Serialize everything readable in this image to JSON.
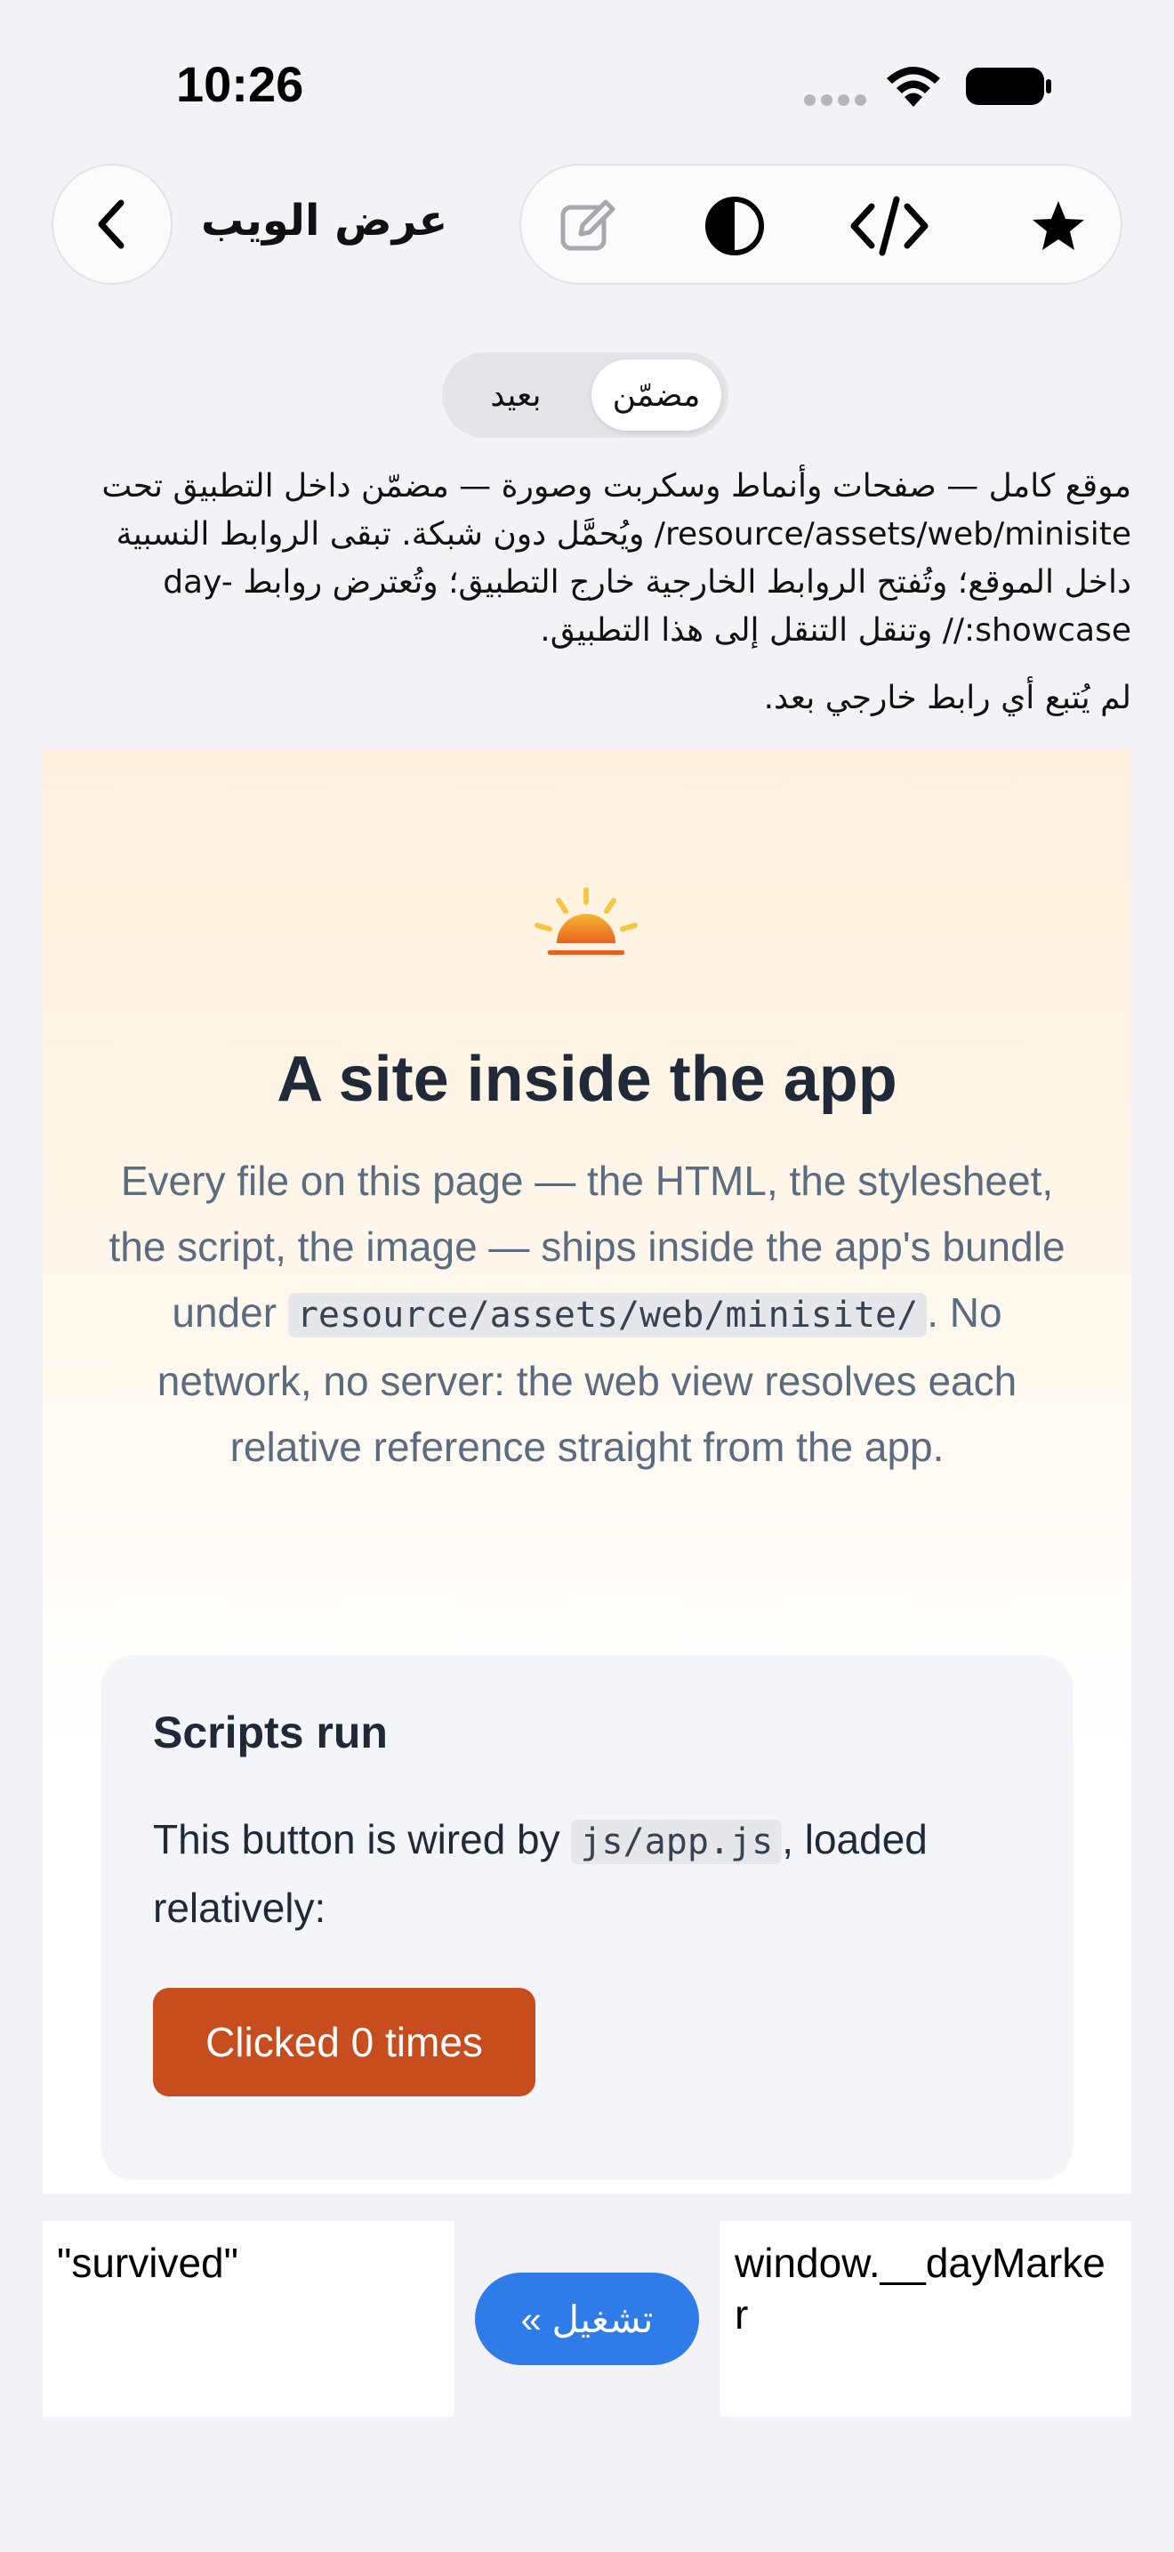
{
  "status_bar": {
    "time": "10:26",
    "icons": [
      "signal-dots-icon",
      "wifi-icon",
      "battery-icon"
    ]
  },
  "nav": {
    "back_icon": "chevron-left-icon",
    "title": "عرض الويب",
    "toolbar_icons": [
      "edit-icon",
      "contrast-icon",
      "code-icon",
      "star-icon"
    ]
  },
  "segmented": {
    "selected": "مضمّن",
    "other": "بعيد"
  },
  "description": "موقع كامل — صفحات وأنماط وسكربت وصورة — مضمّن داخل التطبيق تحت resource/assets/web/minisite/ ويُحمَّل دون شبكة. تبقى الروابط النسبية داخل الموقع؛ وتُفتح الروابط الخارجية خارج التطبيق؛ وتُعترض روابط day-showcase:// وتنقل التنقل إلى هذا التطبيق.",
  "status_message": "لم يُتبع أي رابط خارجي بعد.",
  "site": {
    "title": "A site inside the app",
    "lead_part1": "Every file on this page — the HTML, the stylesheet, the script, the image — ships inside the app's bundle under",
    "lead_code": "resource/assets/web/minisite/",
    "lead_part2": ". No network, no server: the web view resolves each relative reference straight from the app.",
    "card": {
      "title": "Scripts run",
      "text_part1": "This button is wired by",
      "text_code": "js/app.js",
      "text_part2": ", loaded relatively:",
      "button_label": "Clicked 0 times"
    }
  },
  "eval": {
    "result": "\"survived\"",
    "run_label": "تشغيل »",
    "expression": "window.__dayMarker"
  },
  "colors": {
    "background": "#f2f2f7",
    "accent_orange": "#c74d1e",
    "accent_blue": "#2f7be8",
    "title_dark": "#1f2937",
    "lead_gray": "#5b6b80"
  }
}
